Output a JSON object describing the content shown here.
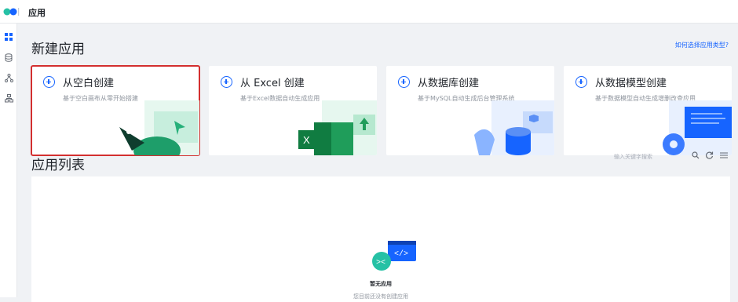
{
  "header": {
    "title": "应用"
  },
  "sidebar": {
    "icons": [
      "grid-icon",
      "database-icon",
      "flow-icon",
      "org-icon"
    ]
  },
  "create_section": {
    "title": "新建应用",
    "help_link": "如何选择应用类型?",
    "cards": [
      {
        "title": "从空白创建",
        "desc": "基于空白画布从零开始搭建"
      },
      {
        "title": "从 Excel 创建",
        "desc": "基于Excel数据自动生成应用"
      },
      {
        "title": "从数据库创建",
        "desc": "基于MySQL自动生成后台管理系统"
      },
      {
        "title": "从数据模型创建",
        "desc": "基于数据模型自动生成增删改查应用"
      }
    ]
  },
  "list_section": {
    "title": "应用列表",
    "search_placeholder": "输入关键字搜索",
    "empty_title": "暂无应用",
    "empty_sub": "您目前还没有创建应用"
  },
  "colors": {
    "accent": "#1664ff",
    "selected_border": "#d32f2f",
    "excel_green": "#107c41"
  }
}
